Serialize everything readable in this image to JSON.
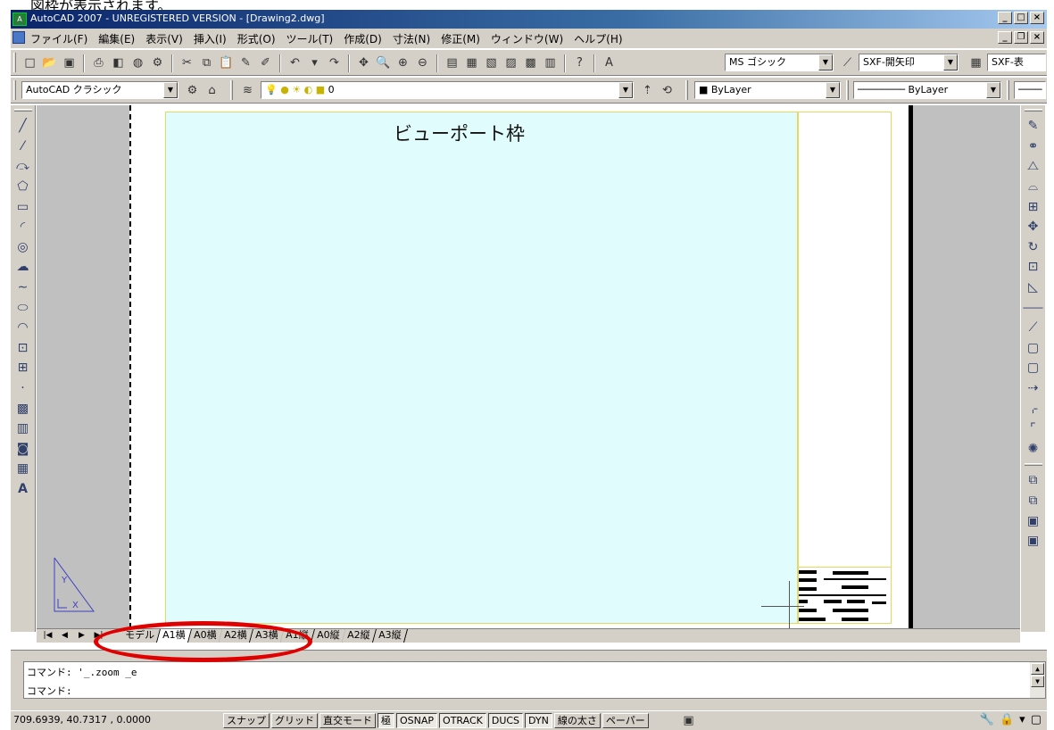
{
  "caption": {
    "text": "図枠が表示されます。"
  },
  "window": {
    "title": "AutoCAD 2007 - UNREGISTERED VERSION - [Drawing2.dwg]",
    "buttons": {
      "minimize": "_",
      "maximize": "□",
      "close": "×"
    }
  },
  "menu": {
    "items": [
      "ファイル(F)",
      "編集(E)",
      "表示(V)",
      "挿入(I)",
      "形式(O)",
      "ツール(T)",
      "作成(D)",
      "寸法(N)",
      "修正(M)",
      "ウィンドウ(W)",
      "ヘルプ(H)"
    ]
  },
  "toolbar1": {
    "text_style": "MS ゴシック",
    "dim_style": "SXF-開矢印",
    "table_style": "SXF-表"
  },
  "toolbar2": {
    "workspace": "AutoCAD クラシック",
    "layer": "0",
    "color": "ByLayer",
    "linetype": "ByLayer"
  },
  "drawing": {
    "viewport_label": "ビューポート枠"
  },
  "layout_tabs": [
    "モデル",
    "A1横",
    "A0横",
    "A2横",
    "A3横",
    "A1縦",
    "A0縦",
    "A2縦",
    "A3縦"
  ],
  "active_tab_index": 1,
  "command": {
    "line1": "コマンド: '_.zoom _e",
    "line2": "コマンド:"
  },
  "status": {
    "coordinates": "709.6939, 40.7317 , 0.0000",
    "buttons": [
      "スナップ",
      "グリッド",
      "直交モード",
      "極",
      "OSNAP",
      "OTRACK",
      "DUCS",
      "DYN",
      "線の太さ",
      "ペーパー"
    ]
  },
  "colors": {
    "title_bar": "#0a246a",
    "viewport_fill": "#e0fcfc",
    "highlight_ring": "#e00000",
    "frame_line": "#e6d860"
  }
}
